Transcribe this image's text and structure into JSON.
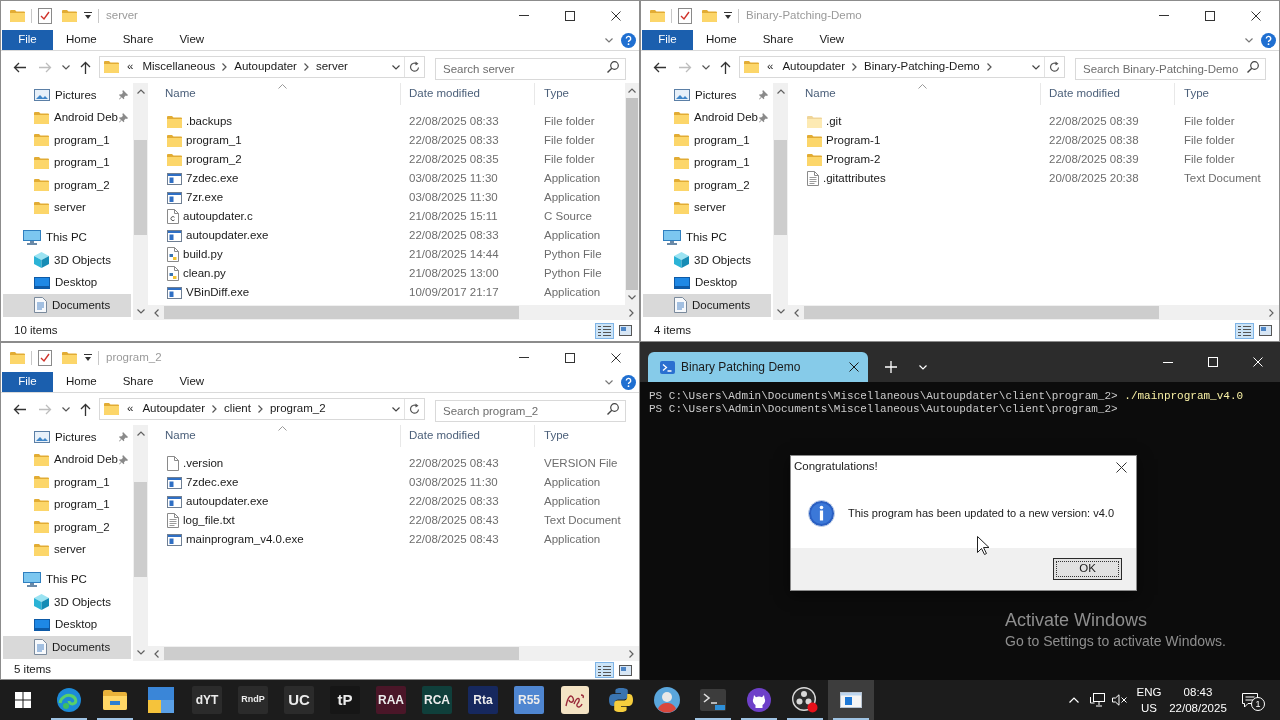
{
  "explorer_windows": [
    {
      "title": "server",
      "ribbon_tabs": [
        {
          "label": "File",
          "kind": "file"
        },
        {
          "label": "Home",
          "kind": "tab"
        },
        {
          "label": "Share",
          "kind": "tab"
        },
        {
          "label": "View",
          "kind": "tab"
        }
      ],
      "back_enabled": true,
      "forward_enabled": false,
      "address": {
        "overflow": "«",
        "crumbs": [
          {
            "label": "Miscellaneous",
            "chevron": true
          },
          {
            "label": "Autoupdater",
            "chevron": true
          },
          {
            "label": "server",
            "chevron": false
          }
        ]
      },
      "search": {
        "placeholder": "Search server"
      },
      "nav_pane": {
        "quick_access": [
          {
            "label": "Pictures",
            "kind": "pictures",
            "pinned": true,
            "selected": false
          },
          {
            "label": "Android Deb",
            "kind": "folder",
            "pinned": true,
            "selected": false
          },
          {
            "label": "program_1",
            "kind": "folder",
            "pinned": false,
            "selected": false
          },
          {
            "label": "program_1",
            "kind": "folder",
            "pinned": false,
            "selected": false
          },
          {
            "label": "program_2",
            "kind": "folder",
            "pinned": false,
            "selected": false
          },
          {
            "label": "server",
            "kind": "folder",
            "pinned": false,
            "selected": false
          }
        ],
        "tree": [
          {
            "label": "This PC",
            "kind": "pc",
            "selected": false,
            "children": [
              {
                "label": "3D Objects",
                "kind": "objects",
                "selected": false
              },
              {
                "label": "Desktop",
                "kind": "desktop",
                "selected": false
              },
              {
                "label": "Documents",
                "kind": "documents",
                "selected": true
              }
            ]
          }
        ]
      },
      "columns": [
        {
          "label": "Name",
          "sorted": true
        },
        {
          "label": "Date modified",
          "sorted": false
        },
        {
          "label": "Type",
          "sorted": false
        }
      ],
      "rows": [
        {
          "name": ".backups",
          "date_modified": "22/08/2025 08:33",
          "type": "File folder",
          "kind": "folder",
          "hidden": false
        },
        {
          "name": "program_1",
          "date_modified": "22/08/2025 08:33",
          "type": "File folder",
          "kind": "folder",
          "hidden": false
        },
        {
          "name": "program_2",
          "date_modified": "22/08/2025 08:35",
          "type": "File folder",
          "kind": "folder",
          "hidden": false
        },
        {
          "name": "7zdec.exe",
          "date_modified": "03/08/2025 11:30",
          "type": "Application",
          "kind": "application",
          "hidden": false
        },
        {
          "name": "7zr.exe",
          "date_modified": "03/08/2025 11:30",
          "type": "Application",
          "kind": "application",
          "hidden": false
        },
        {
          "name": "autoupdater.c",
          "date_modified": "21/08/2025 15:11",
          "type": "C Source",
          "kind": "c-source",
          "hidden": false
        },
        {
          "name": "autoupdater.exe",
          "date_modified": "22/08/2025 08:33",
          "type": "Application",
          "kind": "application",
          "hidden": false
        },
        {
          "name": "build.py",
          "date_modified": "21/08/2025 14:44",
          "type": "Python File",
          "kind": "python",
          "hidden": false
        },
        {
          "name": "clean.py",
          "date_modified": "21/08/2025 13:00",
          "type": "Python File",
          "kind": "python",
          "hidden": false
        },
        {
          "name": "VBinDiff.exe",
          "date_modified": "10/09/2017 21:17",
          "type": "Application",
          "kind": "application",
          "hidden": false
        }
      ],
      "status": "10 items",
      "views": [
        {
          "kind": "details",
          "selected": true
        },
        {
          "kind": "tiles",
          "selected": false
        }
      ]
    },
    {
      "title": "Binary-Patching-Demo",
      "ribbon_tabs": [
        {
          "label": "File",
          "kind": "file"
        },
        {
          "label": "Home",
          "kind": "tab"
        },
        {
          "label": "Share",
          "kind": "tab"
        },
        {
          "label": "View",
          "kind": "tab"
        }
      ],
      "back_enabled": true,
      "forward_enabled": false,
      "address": {
        "overflow": "«",
        "crumbs": [
          {
            "label": "Autoupdater",
            "chevron": true
          },
          {
            "label": "Binary-Patching-Demo",
            "chevron": true
          }
        ]
      },
      "search": {
        "placeholder": "Search Binary-Patching-Demo"
      },
      "nav_pane": {
        "quick_access": [
          {
            "label": "Pictures",
            "kind": "pictures",
            "pinned": true,
            "selected": false
          },
          {
            "label": "Android Deb",
            "kind": "folder",
            "pinned": true,
            "selected": false
          },
          {
            "label": "program_1",
            "kind": "folder",
            "pinned": false,
            "selected": false
          },
          {
            "label": "program_1",
            "kind": "folder",
            "pinned": false,
            "selected": false
          },
          {
            "label": "program_2",
            "kind": "folder",
            "pinned": false,
            "selected": false
          },
          {
            "label": "server",
            "kind": "folder",
            "pinned": false,
            "selected": false
          }
        ],
        "tree": [
          {
            "label": "This PC",
            "kind": "pc",
            "selected": false,
            "children": [
              {
                "label": "3D Objects",
                "kind": "objects",
                "selected": false
              },
              {
                "label": "Desktop",
                "kind": "desktop",
                "selected": false
              },
              {
                "label": "Documents",
                "kind": "documents",
                "selected": true
              }
            ]
          }
        ]
      },
      "columns": [
        {
          "label": "Name",
          "sorted": true
        },
        {
          "label": "Date modified",
          "sorted": false
        },
        {
          "label": "Type",
          "sorted": false
        }
      ],
      "rows": [
        {
          "name": ".git",
          "date_modified": "22/08/2025 08:39",
          "type": "File folder",
          "kind": "folder",
          "hidden": true
        },
        {
          "name": "Program-1",
          "date_modified": "22/08/2025 08:38",
          "type": "File folder",
          "kind": "folder",
          "hidden": false
        },
        {
          "name": "Program-2",
          "date_modified": "22/08/2025 08:39",
          "type": "File folder",
          "kind": "folder",
          "hidden": false
        },
        {
          "name": ".gitattributes",
          "date_modified": "20/08/2025 20:38",
          "type": "Text Document",
          "kind": "text",
          "hidden": false
        }
      ],
      "status": "4 items",
      "views": [
        {
          "kind": "details",
          "selected": true
        },
        {
          "kind": "tiles",
          "selected": false
        }
      ]
    },
    {
      "title": "program_2",
      "ribbon_tabs": [
        {
          "label": "File",
          "kind": "file"
        },
        {
          "label": "Home",
          "kind": "tab"
        },
        {
          "label": "Share",
          "kind": "tab"
        },
        {
          "label": "View",
          "kind": "tab"
        }
      ],
      "back_enabled": true,
      "forward_enabled": false,
      "address": {
        "overflow": "«",
        "crumbs": [
          {
            "label": "Autoupdater",
            "chevron": true
          },
          {
            "label": "client",
            "chevron": true
          },
          {
            "label": "program_2",
            "chevron": false
          }
        ]
      },
      "search": {
        "placeholder": "Search program_2"
      },
      "nav_pane": {
        "quick_access": [
          {
            "label": "Pictures",
            "kind": "pictures",
            "pinned": true,
            "selected": false
          },
          {
            "label": "Android Deb",
            "kind": "folder",
            "pinned": true,
            "selected": false
          },
          {
            "label": "program_1",
            "kind": "folder",
            "pinned": false,
            "selected": false
          },
          {
            "label": "program_1",
            "kind": "folder",
            "pinned": false,
            "selected": false
          },
          {
            "label": "program_2",
            "kind": "folder",
            "pinned": false,
            "selected": false
          },
          {
            "label": "server",
            "kind": "folder",
            "pinned": false,
            "selected": false
          }
        ],
        "tree": [
          {
            "label": "This PC",
            "kind": "pc",
            "selected": false,
            "children": [
              {
                "label": "3D Objects",
                "kind": "objects",
                "selected": false
              },
              {
                "label": "Desktop",
                "kind": "desktop",
                "selected": false
              },
              {
                "label": "Documents",
                "kind": "documents",
                "selected": true
              }
            ]
          }
        ]
      },
      "columns": [
        {
          "label": "Name",
          "sorted": true
        },
        {
          "label": "Date modified",
          "sorted": false
        },
        {
          "label": "Type",
          "sorted": false
        }
      ],
      "rows": [
        {
          "name": ".version",
          "date_modified": "22/08/2025 08:43",
          "type": "VERSION File",
          "kind": "file",
          "hidden": false
        },
        {
          "name": "7zdec.exe",
          "date_modified": "03/08/2025 11:30",
          "type": "Application",
          "kind": "application",
          "hidden": false
        },
        {
          "name": "autoupdater.exe",
          "date_modified": "22/08/2025 08:33",
          "type": "Application",
          "kind": "application",
          "hidden": false
        },
        {
          "name": "log_file.txt",
          "date_modified": "22/08/2025 08:43",
          "type": "Text Document",
          "kind": "text",
          "hidden": false
        },
        {
          "name": "mainprogram_v4.0.exe",
          "date_modified": "22/08/2025 08:43",
          "type": "Application",
          "kind": "application",
          "hidden": false
        }
      ],
      "status": "5 items",
      "views": [
        {
          "kind": "details",
          "selected": true
        },
        {
          "kind": "tiles",
          "selected": false
        }
      ]
    }
  ],
  "terminal": {
    "tabs": [
      {
        "title": "Binary Patching Demo",
        "selected": true
      }
    ],
    "lines": [
      {
        "prompt": "PS C:\\Users\\Admin\\Documents\\Miscellaneous\\Autoupdater\\client\\program_2>",
        "command": "./mainprogram_v4.0"
      },
      {
        "prompt": "PS C:\\Users\\Admin\\Documents\\Miscellaneous\\Autoupdater\\client\\program_2>"
      }
    ]
  },
  "dialog": {
    "title": "Congratulations!",
    "message": "This program has been updated to a new version: v4.0",
    "buttons": [
      {
        "label": "OK",
        "focused": true
      }
    ]
  },
  "activation_notice": {
    "title": "Activate Windows",
    "message": "Go to Settings to activate Windows."
  },
  "taskbar": {
    "apps": [
      {
        "kind": "start",
        "running": false,
        "selected": false
      },
      {
        "kind": "edge",
        "running": true,
        "selected": false
      },
      {
        "kind": "explorer",
        "running": true,
        "selected": false
      },
      {
        "kind": "tiles",
        "running": false,
        "selected": false
      },
      {
        "kind": "text-tile",
        "label": "dYT",
        "color": "#2b2b2b",
        "running": false,
        "selected": false
      },
      {
        "kind": "text-tile",
        "label": "RndP",
        "color": "#2b2b2b",
        "running": false,
        "selected": false
      },
      {
        "kind": "text-tile",
        "label": "UC",
        "color": "#2b2b2b",
        "running": false,
        "selected": false
      },
      {
        "kind": "text-tile",
        "label": "tP",
        "color": "#161616",
        "running": false,
        "selected": false
      },
      {
        "kind": "text-tile",
        "label": "RAA",
        "color": "#4a1628",
        "running": false,
        "selected": false
      },
      {
        "kind": "text-tile",
        "label": "RCA",
        "color": "#0f3f3b",
        "running": false,
        "selected": false
      },
      {
        "kind": "text-tile",
        "label": "Rta",
        "color": "#16285e",
        "running": false,
        "selected": false
      },
      {
        "kind": "text-tile",
        "label": "R55",
        "color": "#4f86d1",
        "running": false,
        "selected": false
      },
      {
        "kind": "seal",
        "running": false,
        "selected": false
      },
      {
        "kind": "python",
        "running": false,
        "selected": false
      },
      {
        "kind": "avatar",
        "running": false,
        "selected": false
      },
      {
        "kind": "terminal",
        "running": true,
        "selected": false
      },
      {
        "kind": "github",
        "running": true,
        "selected": false
      },
      {
        "kind": "obs",
        "running": true,
        "selected": false
      },
      {
        "kind": "window",
        "running": true,
        "selected": true
      }
    ],
    "tray": {
      "language": "ENG",
      "region": "US",
      "time": "08:43",
      "date": "22/08/2025",
      "notifications": "1"
    }
  }
}
